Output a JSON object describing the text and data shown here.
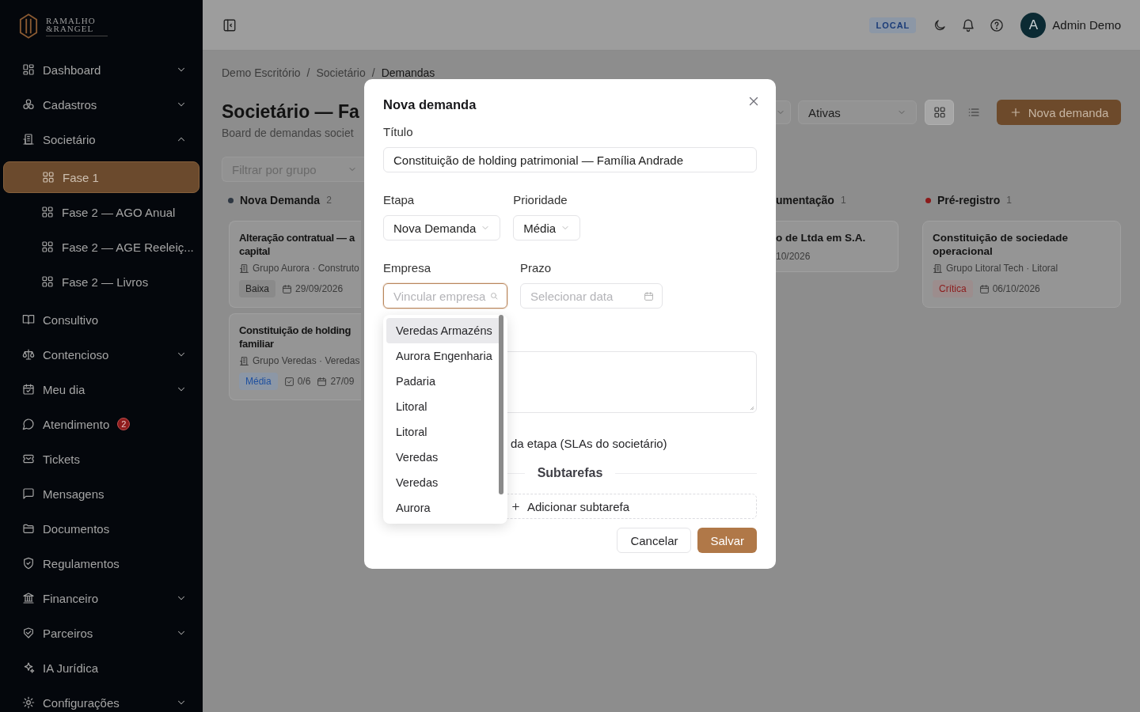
{
  "sidebar": {
    "logo": {
      "line1": "RAMALHO",
      "line2": "&RANGEL"
    },
    "items": [
      {
        "label": "Dashboard",
        "selected": false,
        "expanded": false
      },
      {
        "label": "Cadastros",
        "selected": false,
        "expanded": false
      },
      {
        "label": "Societário",
        "selected": false,
        "expanded": true,
        "children": [
          {
            "label": "Fase 1",
            "selected": true
          },
          {
            "label": "Fase 2 — AGO Anual",
            "selected": false
          },
          {
            "label": "Fase 2 — AGE Reeleiç...",
            "selected": false
          },
          {
            "label": "Fase 2 — Livros",
            "selected": false
          }
        ]
      },
      {
        "label": "Consultivo",
        "selected": false
      },
      {
        "label": "Contencioso",
        "selected": false,
        "expanded": false
      },
      {
        "label": "Meu dia",
        "selected": false,
        "expanded": false
      },
      {
        "label": "Atendimento",
        "selected": false,
        "badge": "2"
      },
      {
        "label": "Tickets",
        "selected": false
      },
      {
        "label": "Mensagens",
        "selected": false
      },
      {
        "label": "Documentos",
        "selected": false
      },
      {
        "label": "Regulamentos",
        "selected": false
      },
      {
        "label": "Financeiro",
        "selected": false,
        "expanded": false
      },
      {
        "label": "Parceiros",
        "selected": false,
        "expanded": false
      },
      {
        "label": "IA Jurídica",
        "selected": false
      },
      {
        "label": "Configurações",
        "selected": false,
        "expanded": false
      }
    ]
  },
  "topbar": {
    "environment": "LOCAL",
    "user": {
      "initial": "A",
      "name": "Admin Demo"
    }
  },
  "breadcrumb": {
    "separator": "/",
    "items": [
      "Demo Escritório",
      "Societário",
      "Demandas"
    ]
  },
  "page": {
    "title": "Societário — Fa",
    "subtitle": "Board de demandas societ",
    "filter": {
      "placeholder": "Filtrar por grupo"
    },
    "status_filter": {
      "value": "Ativas"
    },
    "views": [
      {
        "kind": "grid",
        "selected": true
      },
      {
        "kind": "list",
        "selected": false
      }
    ],
    "new_button": {
      "label": "Nova demanda"
    }
  },
  "board": {
    "columns": [
      {
        "kind": "clipped-right",
        "title": "Nova Demanda",
        "count": "2",
        "color": "#2e3742",
        "cards": [
          {
            "title": "Alteração contratual — a\ncapital",
            "company": "Grupo Aurora · Construto",
            "tag": {
              "text": "Baixa",
              "kind": "low"
            },
            "due": "29/09/2026"
          },
          {
            "title": "Constituição de holding\nfamiliar",
            "company": "Grupo Veredas · Veredas",
            "tag": {
              "text": "Média",
              "kind": "medium"
            },
            "subtasks": "0/6",
            "due": "27/09"
          }
        ]
      },
      {
        "kind": "clipped-left",
        "title": "umentação",
        "count": "1",
        "cards": [
          {
            "title": "o de Ltda em S.A.",
            "due": "10/2026"
          }
        ]
      },
      {
        "kind": "full",
        "title": "Pré-registro",
        "count": "1",
        "color": "#8b1a1a",
        "cards": [
          {
            "title": "Constituição de sociedade\noperacional",
            "company": "Grupo Litoral Tech · Litoral",
            "tag": {
              "text": "Crítica",
              "kind": "critical"
            },
            "due": "06/10/2026"
          }
        ]
      }
    ]
  },
  "modal": {
    "title": "Nova demanda",
    "title_field": {
      "label": "Título",
      "value": "Constituição de holding patrimonial — Família Andrade"
    },
    "stage": {
      "label": "Etapa",
      "value": "Nova Demanda"
    },
    "priority": {
      "label": "Prioridade",
      "value": "Média"
    },
    "company": {
      "label": "Empresa",
      "placeholder": "Vincular empresa",
      "focused": true
    },
    "deadline": {
      "label": "Prazo",
      "placeholder": "Selecionar data"
    },
    "sla_text": "da etapa (SLAs do societário)",
    "subtasks": {
      "heading": "Subtarefas",
      "add_label": "Adicionar subtarefa"
    },
    "buttons": [
      {
        "label": "Cancelar",
        "kind": "secondary"
      },
      {
        "label": "Salvar",
        "kind": "primary"
      }
    ]
  },
  "company_dropdown": {
    "options": [
      {
        "label": "Veredas Armazéns",
        "selected": true
      },
      {
        "label": "Aurora Engenharia",
        "selected": false
      },
      {
        "label": "Padaria",
        "selected": false
      },
      {
        "label": "Litoral",
        "selected": false
      },
      {
        "label": "Litoral",
        "selected": false
      },
      {
        "label": "Veredas",
        "selected": false
      },
      {
        "label": "Veredas",
        "selected": false
      },
      {
        "label": "Aurora",
        "selected": false
      }
    ]
  }
}
